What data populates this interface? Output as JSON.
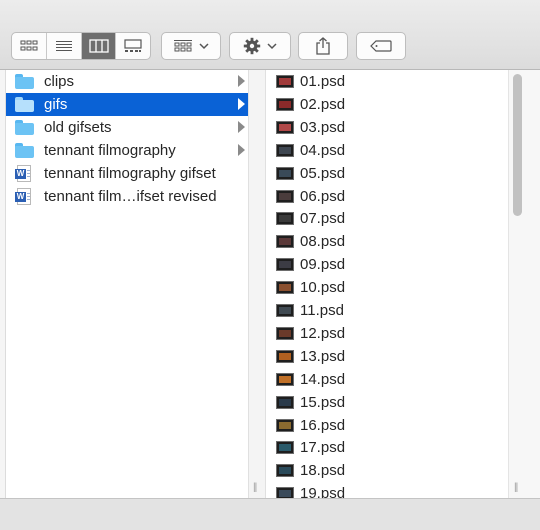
{
  "toolbar": {
    "view_buttons": [
      {
        "name": "icon-view-button",
        "icon": "grid-icon",
        "active": false
      },
      {
        "name": "list-view-button",
        "icon": "list-icon",
        "active": false
      },
      {
        "name": "column-view-button",
        "icon": "columns-icon",
        "active": true
      },
      {
        "name": "gallery-view-button",
        "icon": "gallery-icon",
        "active": false
      }
    ],
    "group_icon": "group-grid-icon",
    "action_icon": "gear-icon",
    "share_icon": "share-icon",
    "tag_icon": "tag-icon"
  },
  "colors": {
    "selection": "#0a62d6",
    "folder": "#6cc3f4",
    "toolbar_active": "#6e6e6e"
  },
  "column1": {
    "items": [
      {
        "label": "clips",
        "icon": "folder-icon",
        "has_children": true,
        "selected": false
      },
      {
        "label": "gifs",
        "icon": "folder-icon",
        "has_children": true,
        "selected": true
      },
      {
        "label": "old gifsets",
        "icon": "folder-icon",
        "has_children": true,
        "selected": false
      },
      {
        "label": "tennant filmography",
        "icon": "folder-icon",
        "has_children": true,
        "selected": false
      },
      {
        "label": "tennant filmography gifset",
        "icon": "word-doc-icon",
        "has_children": false,
        "selected": false
      },
      {
        "label": "tennant film…ifset revised",
        "icon": "word-doc-icon",
        "has_children": false,
        "selected": false
      }
    ]
  },
  "column2": {
    "items": [
      {
        "label": "01.psd",
        "thumb": "#a03a3a"
      },
      {
        "label": "02.psd",
        "thumb": "#8a2a2a"
      },
      {
        "label": "03.psd",
        "thumb": "#b04848"
      },
      {
        "label": "04.psd",
        "thumb": "#3e4650"
      },
      {
        "label": "05.psd",
        "thumb": "#3a4a58"
      },
      {
        "label": "06.psd",
        "thumb": "#4a3c3c"
      },
      {
        "label": "07.psd",
        "thumb": "#3a3a3a"
      },
      {
        "label": "08.psd",
        "thumb": "#5a3838"
      },
      {
        "label": "09.psd",
        "thumb": "#3c3c44"
      },
      {
        "label": "10.psd",
        "thumb": "#8a5030"
      },
      {
        "label": "11.psd",
        "thumb": "#404a52"
      },
      {
        "label": "12.psd",
        "thumb": "#6a3a2a"
      },
      {
        "label": "13.psd",
        "thumb": "#b06020"
      },
      {
        "label": "14.psd",
        "thumb": "#c07028"
      },
      {
        "label": "15.psd",
        "thumb": "#2a3a4a"
      },
      {
        "label": "16.psd",
        "thumb": "#8a6a30"
      },
      {
        "label": "17.psd",
        "thumb": "#2a5a6a"
      },
      {
        "label": "18.psd",
        "thumb": "#2a4a5a"
      },
      {
        "label": "19.psd",
        "thumb": "#3a4a5a"
      }
    ]
  }
}
